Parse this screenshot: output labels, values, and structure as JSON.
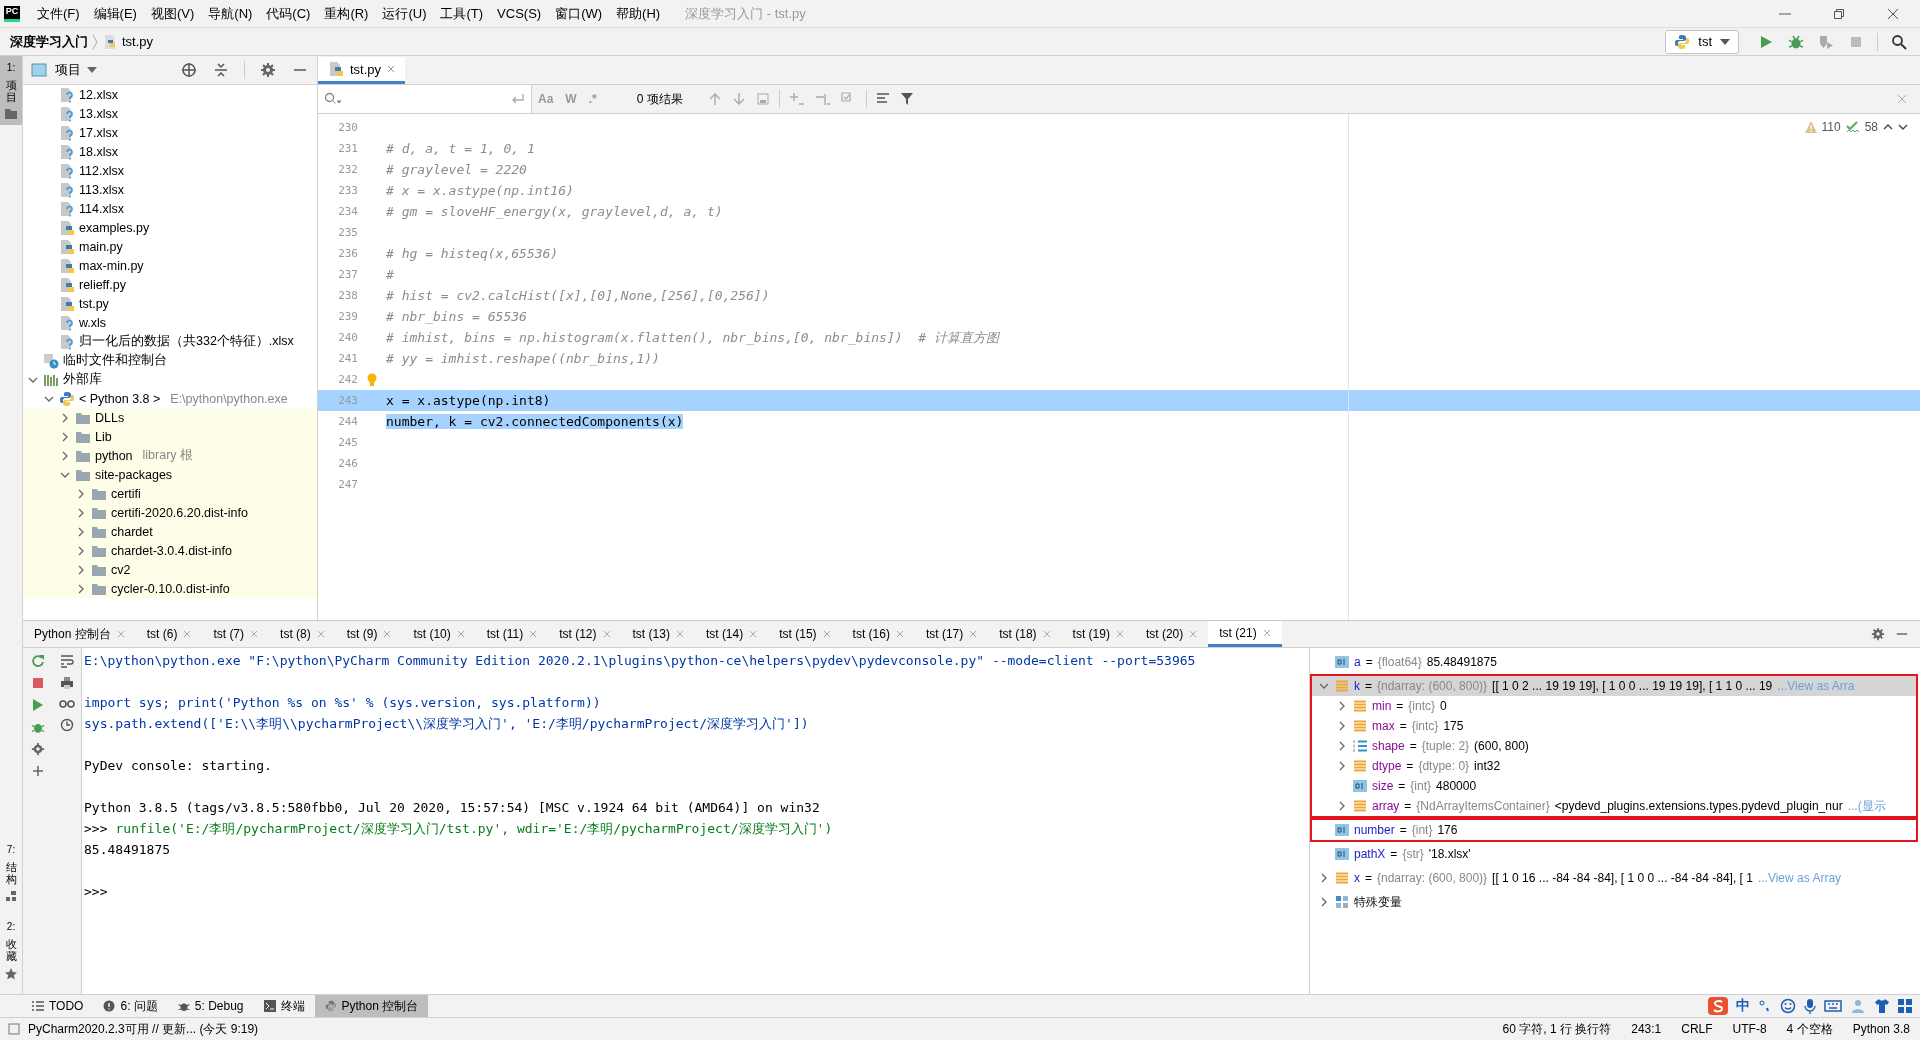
{
  "window": {
    "logo": "PC",
    "title": "深度学习入门 - tst.py"
  },
  "menu": [
    "文件(F)",
    "编辑(E)",
    "视图(V)",
    "导航(N)",
    "代码(C)",
    "重构(R)",
    "运行(U)",
    "工具(T)",
    "VCS(S)",
    "窗口(W)",
    "帮助(H)"
  ],
  "breadcrumb": [
    "深度学习入门",
    "tst.py"
  ],
  "run_config": {
    "label": "tst"
  },
  "side_strip_top": [
    {
      "number": "1:",
      "label": "项目",
      "kind": "project",
      "selected": true
    }
  ],
  "side_strip_bottom": [
    {
      "number": "7:",
      "label": "结构",
      "kind": "structure",
      "selected": false
    },
    {
      "number": "2:",
      "label": "收藏",
      "kind": "favorites",
      "selected": false
    }
  ],
  "project": {
    "title": "项目",
    "files": [
      {
        "label": "12.xlsx",
        "kind": "unknown"
      },
      {
        "label": "13.xlsx",
        "kind": "unknown"
      },
      {
        "label": "17.xlsx",
        "kind": "unknown"
      },
      {
        "label": "18.xlsx",
        "kind": "unknown"
      },
      {
        "label": "112.xlsx",
        "kind": "unknown"
      },
      {
        "label": "113.xlsx",
        "kind": "unknown"
      },
      {
        "label": "114.xlsx",
        "kind": "unknown"
      },
      {
        "label": "examples.py",
        "kind": "python"
      },
      {
        "label": "main.py",
        "kind": "python"
      },
      {
        "label": "max-min.py",
        "kind": "python"
      },
      {
        "label": "relieff.py",
        "kind": "python"
      },
      {
        "label": "tst.py",
        "kind": "python"
      },
      {
        "label": "w.xls",
        "kind": "unknown"
      },
      {
        "label": "归一化后的数据（共332个特征）.xlsx",
        "kind": "unknown"
      }
    ],
    "tree": [
      {
        "label": "临时文件和控制台",
        "kind": "scratch"
      },
      {
        "label": "外部库",
        "kind": "library",
        "expanded": true,
        "children": [
          {
            "label": "< Python 3.8 >",
            "hint": "E:\\python\\python.exe",
            "kind": "sdk",
            "expanded": true,
            "children": [
              {
                "label": "DLLs",
                "kind": "folder",
                "expanded": false
              },
              {
                "label": "Lib",
                "kind": "folder",
                "expanded": false
              },
              {
                "label": "python",
                "hint": "library 根",
                "kind": "folder",
                "expanded": false
              },
              {
                "label": "site-packages",
                "kind": "folder",
                "expanded": true,
                "children": [
                  {
                    "label": "certifi",
                    "kind": "folder",
                    "expanded": false
                  },
                  {
                    "label": "certifi-2020.6.20.dist-info",
                    "kind": "folder",
                    "expanded": false
                  },
                  {
                    "label": "chardet",
                    "kind": "folder",
                    "expanded": false
                  },
                  {
                    "label": "chardet-3.0.4.dist-info",
                    "kind": "folder",
                    "expanded": false
                  },
                  {
                    "label": "cv2",
                    "kind": "folder",
                    "expanded": false
                  },
                  {
                    "label": "cycler-0.10.0.dist-info",
                    "kind": "folder",
                    "expanded": false
                  }
                ]
              }
            ]
          }
        ]
      }
    ]
  },
  "editor": {
    "tab": {
      "label": "tst.py"
    },
    "search": {
      "options": [
        "Aa",
        "W",
        ".*"
      ],
      "result": "0 项结果"
    },
    "inspections": {
      "warnings": "110",
      "weak_warnings": "58"
    },
    "lines": [
      {
        "number": "230",
        "kind": "blank",
        "selected": false
      },
      {
        "number": "231",
        "kind": "comment",
        "text": "# d, a, t = 1, 0, 1",
        "selected": false
      },
      {
        "number": "232",
        "kind": "comment",
        "text": "# graylevel = 2220",
        "selected": false
      },
      {
        "number": "233",
        "kind": "comment",
        "text": "# x = x.astype(np.int16)",
        "selected": false
      },
      {
        "number": "234",
        "kind": "comment",
        "text": "# gm = sloveHF_energy(x, graylevel,d, a, t)",
        "selected": false
      },
      {
        "number": "235",
        "kind": "blank",
        "selected": false
      },
      {
        "number": "236",
        "kind": "comment",
        "text": "# hg = histeq(x,65536)",
        "selected": false
      },
      {
        "number": "237",
        "kind": "comment",
        "text": "#",
        "selected": false
      },
      {
        "number": "238",
        "kind": "comment",
        "text": "# hist = cv2.calcHist([x],[0],None,[256],[0,256])",
        "selected": false
      },
      {
        "number": "239",
        "kind": "comment",
        "text": "# nbr_bins = 65536",
        "selected": false
      },
      {
        "number": "240",
        "kind": "comment",
        "text": "# imhist, bins = np.histogram(x.flatten(), nbr_bins,[0, nbr_bins])  # 计算直方图",
        "selected": false
      },
      {
        "number": "241",
        "kind": "comment",
        "text": "# yy = imhist.reshape((nbr_bins,1))",
        "selected": false
      },
      {
        "number": "242",
        "kind": "blank",
        "intention_bulb": true,
        "selected": false
      },
      {
        "number": "243",
        "kind": "code",
        "text": "x = x.astype(np.int8)",
        "selected": true
      },
      {
        "number": "244",
        "kind": "code",
        "text": "number, k = cv2.connectedComponents(x)",
        "selected": true
      },
      {
        "number": "245",
        "kind": "blank",
        "selected": false
      },
      {
        "number": "246",
        "kind": "blank",
        "selected": false
      },
      {
        "number": "247",
        "kind": "blank",
        "selected": false
      }
    ]
  },
  "console_tabs": [
    {
      "label": "Python 控制台",
      "selected": false
    },
    {
      "label": "tst (6)",
      "selected": false
    },
    {
      "label": "tst (7)",
      "selected": false
    },
    {
      "label": "tst (8)",
      "selected": false
    },
    {
      "label": "tst (9)",
      "selected": false
    },
    {
      "label": "tst (10)",
      "selected": false
    },
    {
      "label": "tst (11)",
      "selected": false
    },
    {
      "label": "tst (12)",
      "selected": false
    },
    {
      "label": "tst (13)",
      "selected": false
    },
    {
      "label": "tst (14)",
      "selected": false
    },
    {
      "label": "tst (15)",
      "selected": false
    },
    {
      "label": "tst (16)",
      "selected": false
    },
    {
      "label": "tst (17)",
      "selected": false
    },
    {
      "label": "tst (18)",
      "selected": false
    },
    {
      "label": "tst (19)",
      "selected": false
    },
    {
      "label": "tst (20)",
      "selected": false
    },
    {
      "label": "tst (21)",
      "selected": true
    }
  ],
  "console": [
    {
      "kind": "command",
      "text": "E:\\python\\python.exe \"F:\\python\\PyCharm Community Edition 2020.2.1\\plugins\\python-ce\\helpers\\pydev\\pydevconsole.py\" --mode=client --port=53965"
    },
    {
      "kind": "blank"
    },
    {
      "kind": "command",
      "text": "import sys; print('Python %s on %s' % (sys.version, sys.platform))"
    },
    {
      "kind": "command",
      "text": "sys.path.extend(['E:\\\\李明\\\\pycharmProject\\\\深度学习入门', 'E:/李明/pycharmProject/深度学习入门'])"
    },
    {
      "kind": "blank"
    },
    {
      "kind": "output",
      "text": "PyDev console: starting."
    },
    {
      "kind": "blank"
    },
    {
      "kind": "output",
      "text": "Python 3.8.5 (tags/v3.8.5:580fbb0, Jul 20 2020, 15:57:54) [MSC v.1924 64 bit (AMD64)] on win32"
    },
    {
      "kind": "input",
      "prompt": ">>>",
      "text": "runfile('E:/李明/pycharmProject/深度学习入门/tst.py', wdir='E:/李明/pycharmProject/深度学习入门')"
    },
    {
      "kind": "output",
      "text": "85.48491875"
    },
    {
      "kind": "blank"
    },
    {
      "kind": "input",
      "prompt": ">>>"
    }
  ],
  "variables": [
    {
      "name": "a",
      "eq": "=",
      "type": "{float64}",
      "value": "85.48491875",
      "kind": "scalar",
      "selected": false,
      "outlined": false
    },
    {
      "name": "k",
      "eq": "=",
      "type": "{ndarray: (600, 800)}",
      "value": "[[ 1  0  2 ... 19 19 19], [ 1  0  0 ... 19 19 19], [ 1  1  0 ... 19",
      "link": "...View as Arra",
      "kind": "array",
      "expanded": true,
      "selected": true,
      "outlined": true,
      "children": [
        {
          "name": "min",
          "eq": "=",
          "type": "{intc}",
          "value": "0",
          "kind": "array",
          "expanded": false
        },
        {
          "name": "max",
          "eq": "=",
          "type": "{intc}",
          "value": "175",
          "kind": "array",
          "expanded": false
        },
        {
          "name": "shape",
          "eq": "=",
          "type": "{tuple: 2}",
          "value": "(600, 800)",
          "kind": "tuple",
          "expanded": false
        },
        {
          "name": "dtype",
          "eq": "=",
          "type": "{dtype: 0}",
          "value": "int32",
          "kind": "array",
          "expanded": false
        },
        {
          "name": "size",
          "eq": "=",
          "type": "{int}",
          "value": "480000",
          "kind": "scalar"
        },
        {
          "name": "array",
          "eq": "=",
          "type": "{NdArrayItemsContainer}",
          "value": "<pydevd_plugins.extensions.types.pydevd_plugin_nur",
          "link": "...(显示",
          "kind": "array",
          "expanded": false
        }
      ]
    },
    {
      "name": "number",
      "eq": "=",
      "type": "{int}",
      "value": "176",
      "kind": "scalar",
      "selected": false,
      "outlined": true
    },
    {
      "name": "pathX",
      "eq": "=",
      "type": "{str}",
      "value": "'18.xlsx'",
      "kind": "scalar",
      "selected": false,
      "outlined": false
    },
    {
      "name": "x",
      "eq": "=",
      "type": "{ndarray: (600, 800)}",
      "value": "[[  1   0  16 ... -84 -84 -84], [  1   0   0 ... -84 -84 -84], [  1",
      "link": "...View as Array",
      "kind": "array",
      "expanded": false,
      "selected": false,
      "outlined": false
    },
    {
      "name": "特殊变量",
      "kind": "special",
      "expanded": false,
      "selected": false,
      "outlined": false
    }
  ],
  "tool_windows": [
    {
      "label": "TODO",
      "kind": "todo",
      "selected": false
    },
    {
      "label": "6: 问题",
      "kind": "problems",
      "selected": false
    },
    {
      "label": "5: Debug",
      "kind": "debug",
      "selected": false
    },
    {
      "label": "终端",
      "kind": "terminal",
      "selected": false
    },
    {
      "label": "Python 控制台",
      "kind": "console",
      "selected": true
    }
  ],
  "ime": {
    "label": "中"
  },
  "status_bar": {
    "message": "PyCharm2020.2.3可用 // 更新... (今天 9:19)",
    "items": [
      "60 字符, 1 行 换行符",
      "243:1",
      "CRLF",
      "UTF-8",
      "4 个空格",
      "Python 3.8"
    ]
  }
}
